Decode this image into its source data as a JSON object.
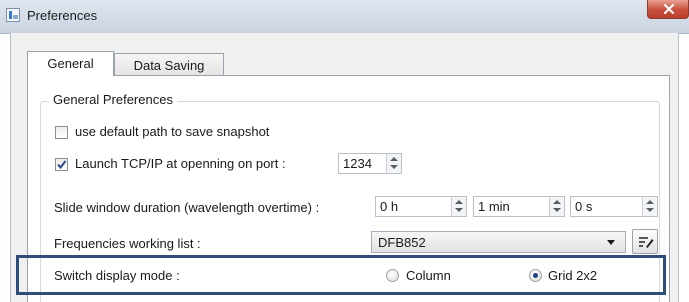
{
  "window": {
    "title": "Preferences"
  },
  "tabs": [
    {
      "label": "General",
      "selected": true
    },
    {
      "label": "Data Saving",
      "selected": false
    }
  ],
  "group": {
    "title": "General Preferences"
  },
  "options": {
    "default_path": {
      "label": "use default path to save snapshot",
      "checked": false
    },
    "launch_tcp": {
      "label": "Launch TCP/IP at openning on port :",
      "checked": true,
      "port": "1234"
    }
  },
  "slide_window": {
    "label": "Slide window duration (wavelength overtime) :",
    "hours": "0 h",
    "minutes": "1 min",
    "seconds": "0 s"
  },
  "frequencies": {
    "label": "Frequencies working list :",
    "selected": "DFB852"
  },
  "display_mode": {
    "label": "Switch display mode :",
    "options": [
      {
        "label": "Column",
        "selected": false
      },
      {
        "label": "Grid 2x2",
        "selected": true
      }
    ]
  },
  "colors": {
    "highlight_border": "#2e4d7a",
    "close_button": "#c9503c",
    "radio_dot": "#1f3f8a"
  },
  "icons": {
    "app": "app-icon",
    "close": "close-icon",
    "edit_list": "edit-list-icon",
    "checkmark": "checkmark-icon"
  }
}
